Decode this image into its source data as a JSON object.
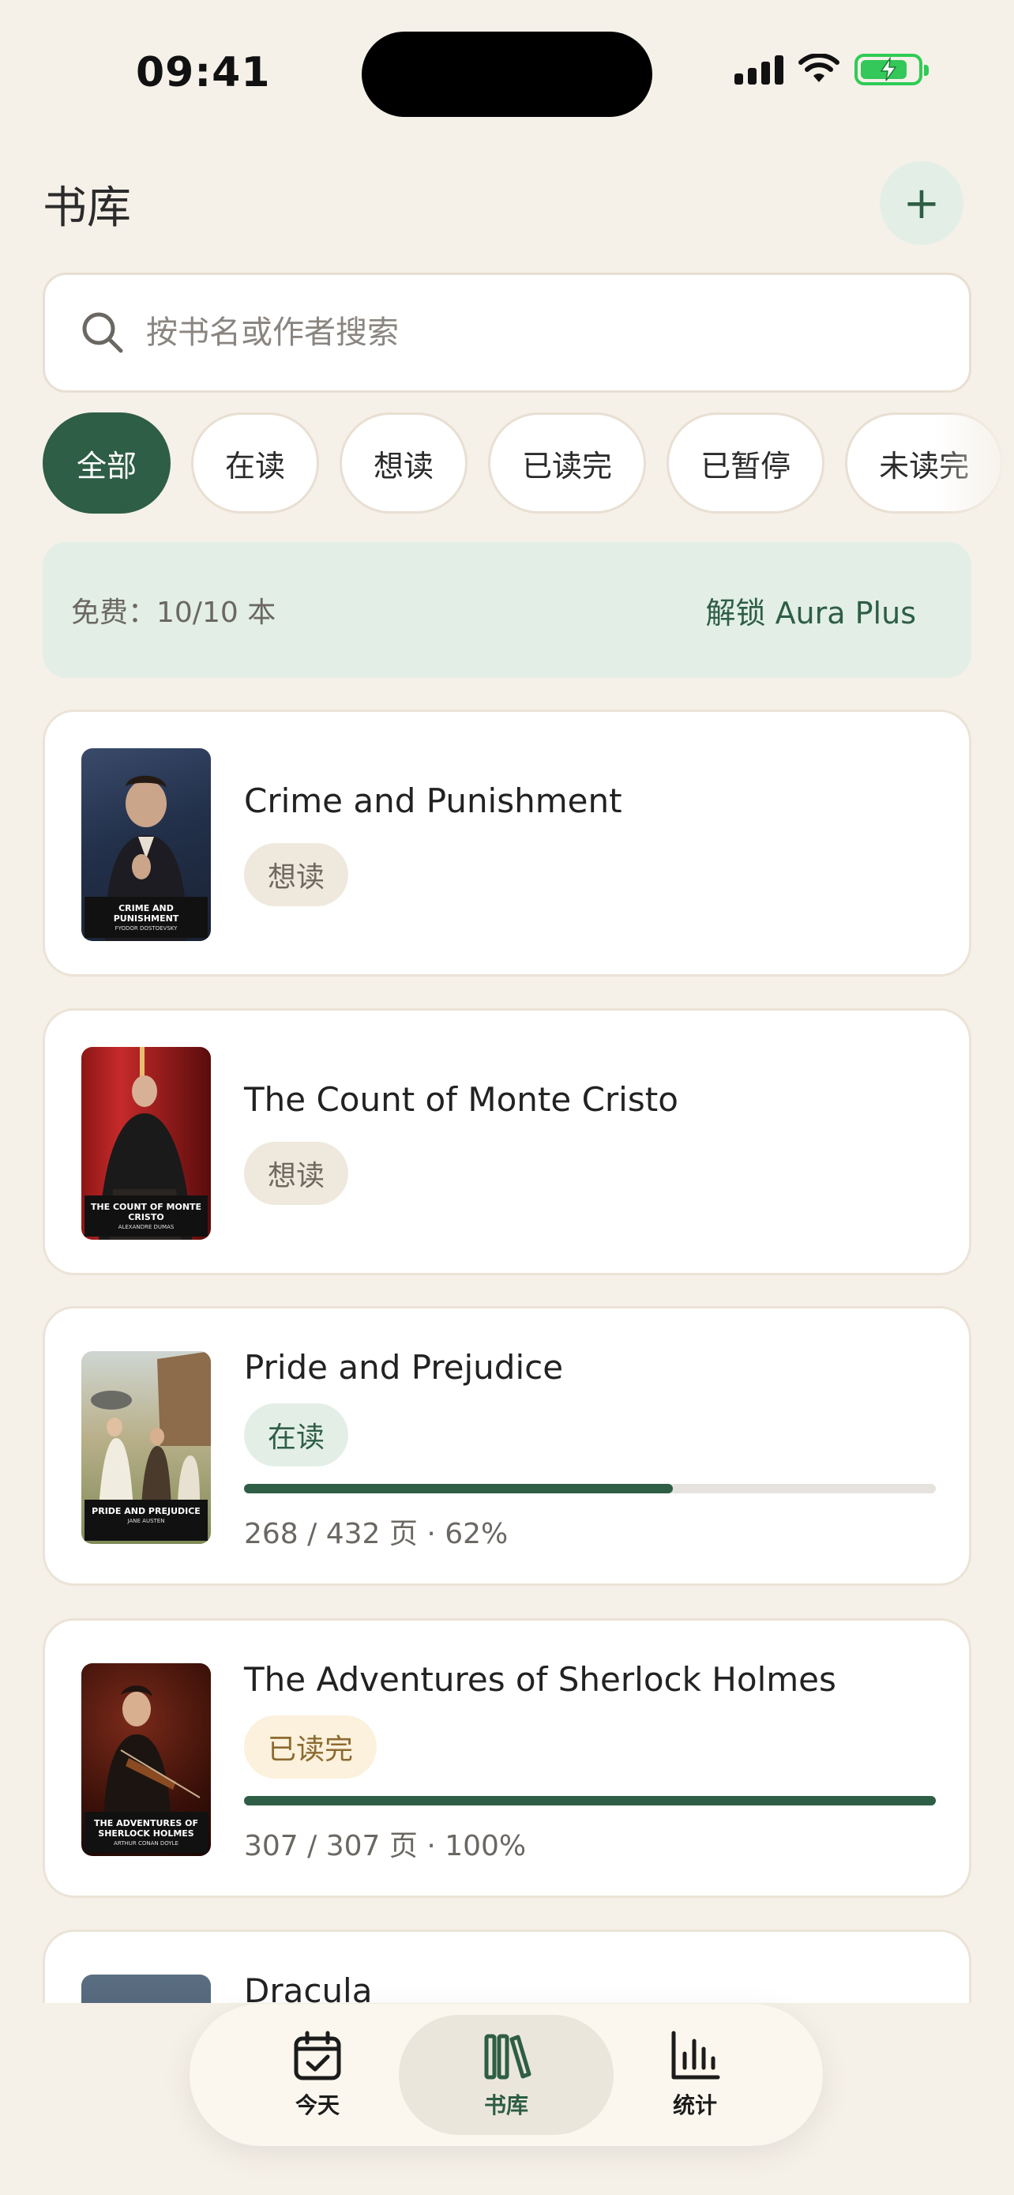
{
  "status_bar": {
    "time": "09:41"
  },
  "header": {
    "title": "书库",
    "add_label": "+"
  },
  "search": {
    "placeholder": "按书名或作者搜索"
  },
  "filters": [
    "全部",
    "在读",
    "想读",
    "已读完",
    "已暂停",
    "未读完"
  ],
  "active_filter": "全部",
  "quota": {
    "text": "免费：10/10 本",
    "link": "解锁 Aura Plus"
  },
  "books": [
    {
      "title": "Crime and Punishment",
      "status": "想读",
      "cover_title": "CRIME AND PUNISHMENT",
      "cover_author": "FYODOR DOSTOEVSKY"
    },
    {
      "title": "The Count of Monte Cristo",
      "status": "想读",
      "cover_title": "THE COUNT OF MONTE CRISTO",
      "cover_author": "ALEXANDRE DUMAS"
    },
    {
      "title": "Pride and Prejudice",
      "status": "在读",
      "progress": 0.62,
      "progress_text": "268 / 432 页 · 62%",
      "cover_title": "PRIDE AND PREJUDICE",
      "cover_author": "JANE AUSTEN"
    },
    {
      "title": "The Adventures of Sherlock Holmes",
      "status": "已读完",
      "progress": 1.0,
      "progress_text": "307 / 307 页 · 100%",
      "cover_title": "THE ADVENTURES OF SHERLOCK HOLMES",
      "cover_author": "ARTHUR CONAN DOYLE"
    },
    {
      "title": "Dracula"
    }
  ],
  "nav": [
    {
      "label": "今天",
      "icon": "calendar-check-icon"
    },
    {
      "label": "书库",
      "icon": "books-icon",
      "active": true
    },
    {
      "label": "统计",
      "icon": "bar-chart-icon"
    }
  ],
  "colors": {
    "accent": "#2e5e45",
    "background": "#f5f0e8",
    "accent_soft": "#e3efe6"
  }
}
